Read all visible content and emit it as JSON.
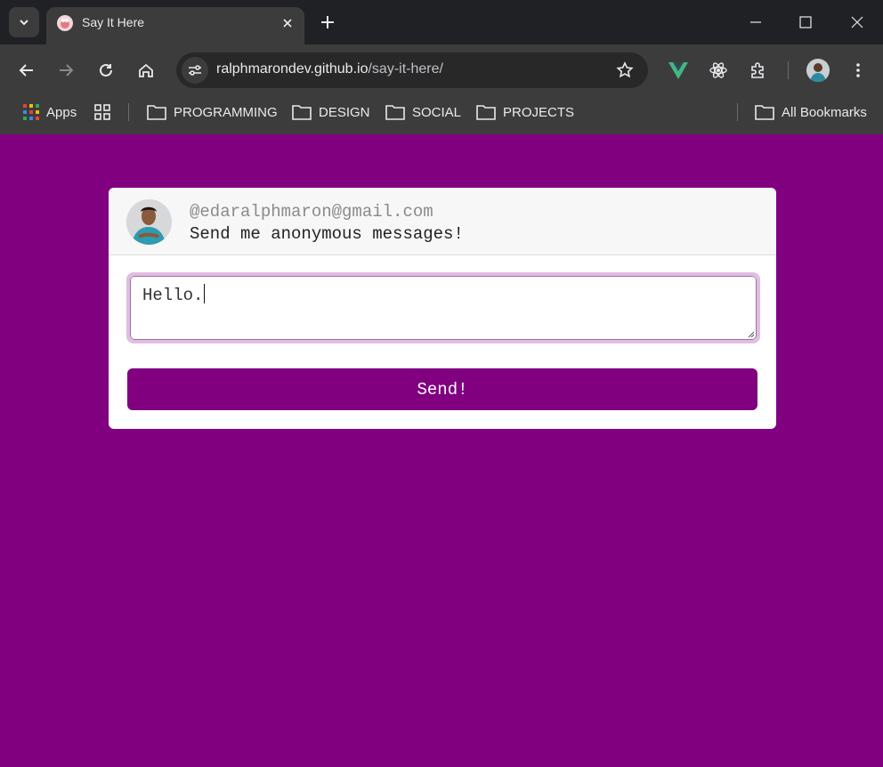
{
  "browser": {
    "tab_title": "Say It Here",
    "url_host": "ralphmarondev.github.io",
    "url_path": "/say-it-here/",
    "bookmarks": [
      {
        "label": "Apps"
      },
      {
        "label": "PROGRAMMING"
      },
      {
        "label": "DESIGN"
      },
      {
        "label": "SOCIAL"
      },
      {
        "label": "PROJECTS"
      }
    ],
    "all_bookmarks_label": "All Bookmarks"
  },
  "page": {
    "email": "@edaralphmaron@gmail.com",
    "tagline": "Send me anonymous messages!",
    "message_value": "Hello.",
    "send_label": "Send!"
  },
  "colors": {
    "page_background": "#800080",
    "button": "#800080",
    "input_focus_ring": "#e2bde2"
  }
}
